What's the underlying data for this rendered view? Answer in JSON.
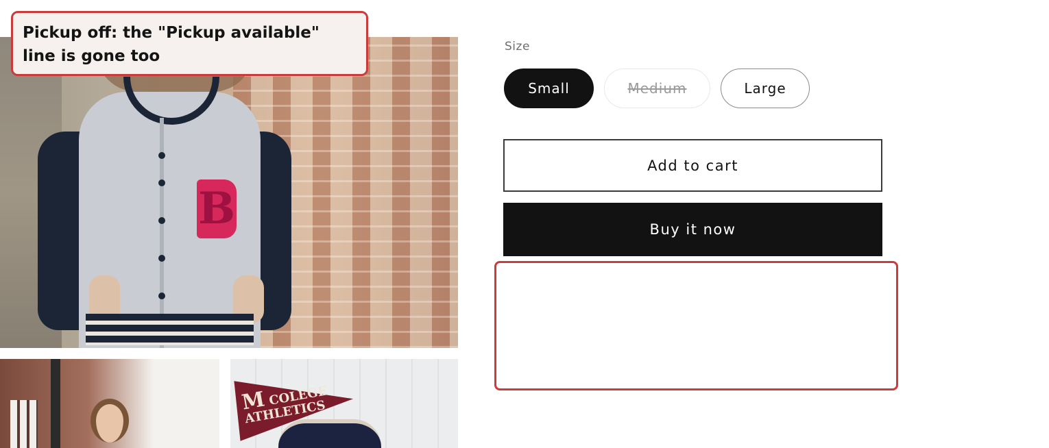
{
  "annotation": {
    "lines": [
      "Pickup off: the \"Pickup available\"",
      "line is gone too"
    ],
    "accent_color": "#cc3b3b"
  },
  "gallery": {
    "thumbnail_2": {
      "pennant_letter": "M",
      "pennant_lines": [
        "COLEGE",
        "ATHLETICS"
      ]
    }
  },
  "product": {
    "size_label": "Size",
    "sizes": [
      {
        "label": "Small",
        "state": "selected"
      },
      {
        "label": "Medium",
        "state": "unavailable"
      },
      {
        "label": "Large",
        "state": "available"
      }
    ],
    "add_to_cart_label": "Add to cart",
    "buy_now_label": "Buy it now",
    "pickup_availability_text": ""
  },
  "colors": {
    "primary_dark": "#121212",
    "highlight": "#cc3b3b"
  }
}
